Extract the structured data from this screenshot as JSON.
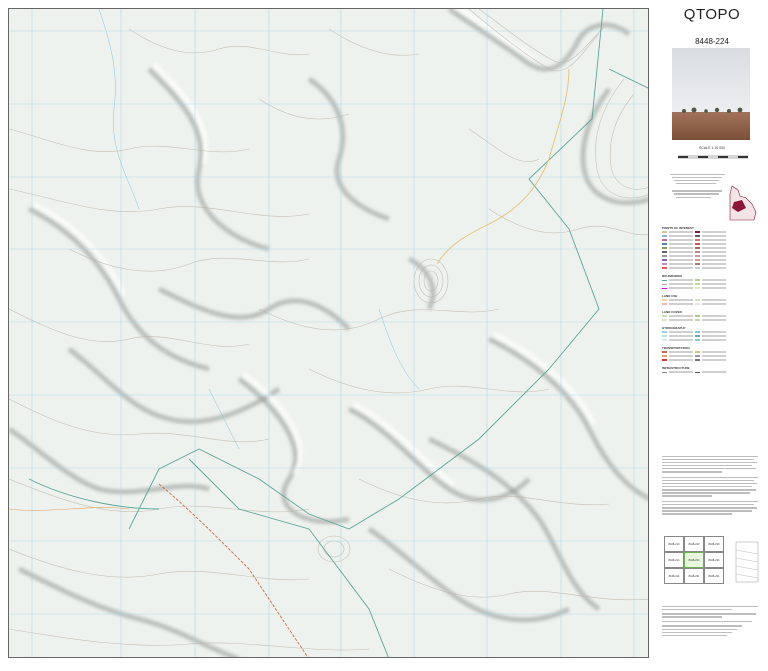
{
  "map": {
    "title": "QTOPO",
    "map_number": "8448-224",
    "scale": "SCALE 1:10 000",
    "index_sheets": [
      "8448-213",
      "8448-223",
      "8448-233",
      "8448-214",
      "8448-224",
      "8448-234",
      "8448-211",
      "8448-221",
      "8448-231"
    ],
    "legend_headings": [
      "POINTS OF INTEREST",
      "BOUNDARIES",
      "LAND USE",
      "LAND COVER",
      "HYDROGRAPHY",
      "TRANSPORTATION",
      "INFRASTRUCTURE"
    ],
    "colors": {
      "map_background": "#eef2ee",
      "contour": "#b9b0a4",
      "hillshade": "#9aa3a0",
      "grid": "#9fd4e6",
      "boundary": "#5aa69a",
      "road": "#cc6a4a",
      "track": "#e2c36a",
      "locator_region": "#8b1538"
    },
    "icons": [
      "photo-thumbnail",
      "locator-map-of-queensland",
      "scale-bar",
      "north-arrow"
    ]
  }
}
